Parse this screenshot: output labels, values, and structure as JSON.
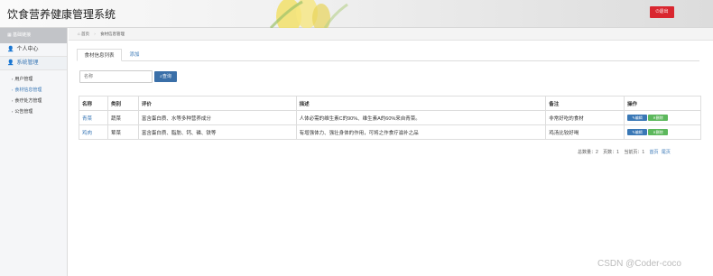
{
  "header": {
    "app_title": "饮食营养健康管理系统",
    "logout_label": "退出",
    "accent_color": "#d9262f"
  },
  "sidebar": {
    "top_label": "基础链接",
    "sections": [
      {
        "label": "个人中心",
        "icon": "user-icon"
      },
      {
        "label": "系统管理",
        "icon": "user-icon"
      }
    ],
    "items": [
      {
        "label": "用户管理"
      },
      {
        "label": "食材信息管理"
      },
      {
        "label": "食疗处方管理"
      },
      {
        "label": "公告管理"
      }
    ]
  },
  "breadcrumb": {
    "home": "首页",
    "current": "食材信息管理"
  },
  "tabs": [
    {
      "label": "食材信息列表"
    },
    {
      "label": "添加"
    }
  ],
  "search": {
    "placeholder": "名称",
    "button_label": "查询"
  },
  "table": {
    "headers": [
      "名称",
      "类别",
      "评价",
      "描述",
      "备注",
      "操作"
    ],
    "rows": [
      {
        "name": "青菜",
        "category": "蔬菜",
        "evaluation": "富含蛋白质、水等多种营养成分",
        "description": "人体必需的维生素C的90%、维生素A的60%来自青菜。",
        "note": "非常好吃的食材"
      },
      {
        "name": "鸡肉",
        "category": "荤菜",
        "evaluation": "富含蛋白质、脂肪、钙、磷、铁等",
        "description": "有增强体力、强壮身体的作用，可将之作食疗滋补之品",
        "note": "鸡汤比较好喝"
      }
    ],
    "edit_label": "编辑",
    "delete_label": "删除"
  },
  "pager": {
    "total": "总数量：2",
    "pages": "页数：1",
    "current": "当前页：1",
    "first": "首页",
    "last": "尾页"
  },
  "watermark": "CSDN @Coder-coco"
}
